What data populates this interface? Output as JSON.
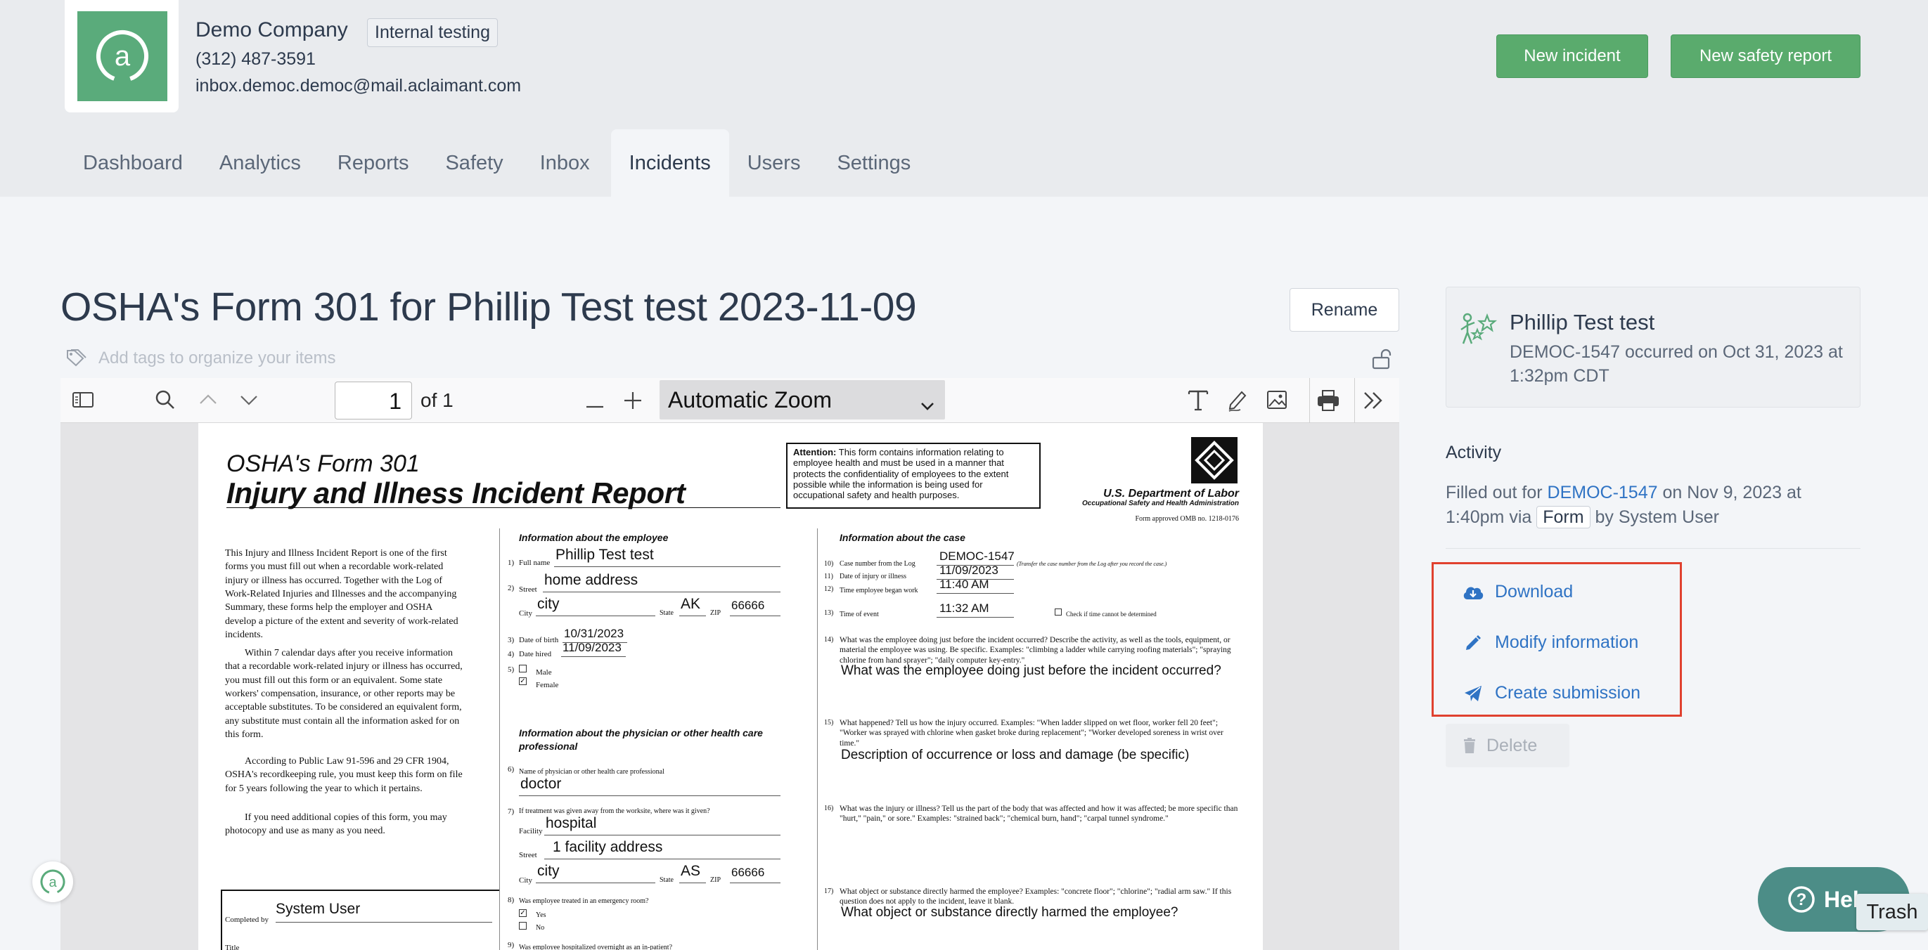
{
  "company": {
    "name": "Demo Company",
    "badge": "Internal testing",
    "phone": "(312) 487-3591",
    "email": "inbox.democ.democ@mail.aclaimant.com"
  },
  "header_buttons": {
    "new_incident": "New incident",
    "new_safety_report": "New safety report"
  },
  "nav": {
    "tabs": [
      {
        "label": "Dashboard"
      },
      {
        "label": "Analytics"
      },
      {
        "label": "Reports"
      },
      {
        "label": "Safety"
      },
      {
        "label": "Inbox"
      },
      {
        "label": "Incidents",
        "active": true
      },
      {
        "label": "Users"
      },
      {
        "label": "Settings"
      }
    ]
  },
  "page": {
    "title": "OSHA's Form 301 for Phillip Test test 2023-11-09",
    "rename_label": "Rename",
    "tags_placeholder": "Add tags to organize your items"
  },
  "pdf_viewer": {
    "page_number": "1",
    "page_count_label": "of 1",
    "zoom": "Automatic Zoom"
  },
  "pdf": {
    "form_label": "OSHA's Form 301",
    "form_title": "Injury and Illness Incident Report",
    "attention_bold": "Attention:",
    "attention_text": "This form contains information relating to employee health and must be used in a manner that protects the confidentiality of employees to the extent possible while the information is being used for occupational safety and health purposes.",
    "dept": "U.S. Department of Labor",
    "dept_sub": "Occupational Safety and Health Administration",
    "omb": "Form approved OMB no. 1218-0176",
    "intro_p1": "This Injury and Illness Incident Report is one of the first forms you must fill out when a recordable work-related injury or illness has occurred. Together with the Log of Work-Related Injuries and Illnesses and the accompanying Summary, these forms help the employer and OSHA develop a picture of the extent and severity of work-related incidents.",
    "intro_p2": "Within 7 calendar days after you receive information that a recordable work-related injury or illness has occurred, you must fill out this form or an equivalent. Some state workers' compensation, insurance, or other reports may be acceptable substitutes. To be considered an equivalent form, any substitute must contain all the information asked for on this form.",
    "intro_p3": "According to Public Law 91-596 and 29 CFR 1904, OSHA's recordkeeping rule, you must keep this form on file for 5 years following the year to which it pertains.",
    "intro_p4": "If you need additional copies of this form, you may photocopy and use as many as you need.",
    "completed_by_label": "Completed by",
    "completed_by": "System User",
    "title_label": "Title",
    "emp_heading": "Information about the employee",
    "q1": "1)",
    "full_name_label": "Full name",
    "full_name": "Phillip Test test",
    "q2": "2)",
    "street_label": "Street",
    "street": "home address",
    "city_label": "City",
    "city": "city",
    "state_label": "State",
    "state": "AK",
    "zip_label": "ZIP",
    "zip": "66666",
    "q3": "3)",
    "dob_label": "Date of birth",
    "dob": "10/31/2023",
    "q4": "4)",
    "hired_label": "Date hired",
    "hired": "11/09/2023",
    "q5": "5)",
    "male_label": "Male",
    "female_label": "Female",
    "phys_heading": "Information about the physician or other health care professional",
    "q6": "6)",
    "phys_label": "Name of physician or other health care professional",
    "phys": "doctor",
    "q7": "7)",
    "treat_label": "If treatment was given away from the worksite, where was it given?",
    "facility_label": "Facility",
    "facility": "hospital",
    "fac_street": "1 facility address",
    "fac_city": "city",
    "fac_state": "AS",
    "fac_zip": "66666",
    "q8": "8)",
    "er_label": "Was employee treated in an emergency room?",
    "yes_label": "Yes",
    "no_label": "No",
    "q9": "9)",
    "hosp_label": "Was employee hospitalized overnight as an in-patient?",
    "case_heading": "Information about the case",
    "q10": "10)",
    "case_label": "Case number from the Log",
    "case_number": "DEMOC-1547",
    "case_note": "(Transfer the case number from the Log after you record the case.)",
    "q11": "11)",
    "inj_date_label": "Date of injury or illness",
    "inj_date": "11/09/2023",
    "q12": "12)",
    "began_label": "Time employee began work",
    "began": "11:40 AM",
    "q13": "13)",
    "event_label": "Time of event",
    "event_time": "11:32 AM",
    "check_label": "Check if time cannot be determined",
    "q14": "14)",
    "q14_text": "What was the employee doing just before the incident occurred? Describe the activity, as well as the tools, equipment, or material the employee was using. Be specific. Examples: \"climbing a ladder while carrying roofing materials\"; \"spraying chlorine from hand sprayer\"; \"daily computer key-entry.\"",
    "q14_answer": "What was the employee doing just before the incident occurred?",
    "q15": "15)",
    "q15_text": "What happened? Tell us how the injury occurred. Examples: \"When ladder slipped on wet floor, worker fell 20 feet\"; \"Worker was sprayed with chlorine when gasket broke during replacement\"; \"Worker developed soreness in wrist over time.\"",
    "q15_answer": "Description of occurrence or loss and damage (be specific)",
    "q16": "16)",
    "q16_text": "What was the injury or illness? Tell us the part of the body that was affected and how it was affected; be more specific than \"hurt,\" \"pain,\" or sore.\" Examples: \"strained back\"; \"chemical burn, hand\"; \"carpal tunnel syndrome.\"",
    "q17": "17)",
    "q17_text": "What object or substance directly harmed the employee? Examples: \"concrete floor\"; \"chlorine\"; \"radial arm saw.\" If this question does not apply to the incident, leave it blank.",
    "q17_answer": "What object or substance directly harmed the employee?"
  },
  "person": {
    "name": "Phillip Test test",
    "detail": "DEMOC-1547 occurred on Oct 31, 2023 at 1:32pm CDT"
  },
  "activity": {
    "title": "Activity",
    "prefix": "Filled out for",
    "link": "DEMOC-1547",
    "middle": "on Nov 9, 2023 at 1:40pm via",
    "badge": "Form",
    "suffix": "by System User"
  },
  "actions": {
    "download": "Download",
    "modify": "Modify information",
    "submission": "Create submission",
    "delete": "Delete"
  },
  "help": {
    "label": "Help",
    "tooltip": "Trash"
  },
  "colors": {
    "brand_green": "#5aab7b",
    "button_green": "#5aab6d",
    "link_blue": "#2f73c4",
    "highlight_red": "#e0412f",
    "help_teal": "#4c8d87"
  }
}
